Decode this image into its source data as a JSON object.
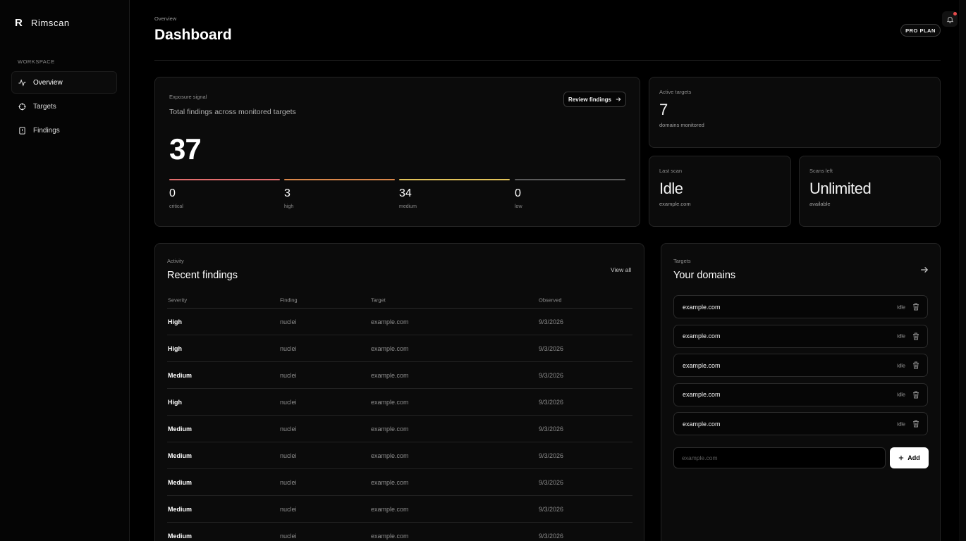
{
  "brand": {
    "mark": "R",
    "name": "Rimscan"
  },
  "sidebar": {
    "section_label": "WORKSPACE",
    "items": [
      {
        "label": "Overview",
        "icon": "activity-icon",
        "active": true
      },
      {
        "label": "Targets",
        "icon": "crosshair-icon",
        "active": false
      },
      {
        "label": "Findings",
        "icon": "file-icon",
        "active": false
      }
    ]
  },
  "header": {
    "breadcrumb": "Overview",
    "title": "Dashboard",
    "plan_badge": "PRO PLAN"
  },
  "exposure": {
    "label": "Exposure signal",
    "subtitle": "Total findings across monitored targets",
    "total": "37",
    "review_button": "Review findings",
    "severities": [
      {
        "count": "0",
        "label": "critical",
        "color": "#e26d6d"
      },
      {
        "count": "3",
        "label": "high",
        "color": "#d9874a"
      },
      {
        "count": "34",
        "label": "medium",
        "color": "#e2c35a"
      },
      {
        "count": "0",
        "label": "low",
        "color": "#5a5a5a"
      }
    ]
  },
  "stats": {
    "active_targets": {
      "label": "Active targets",
      "value": "7",
      "caption": "domains monitored"
    },
    "last_scan": {
      "label": "Last scan",
      "value": "Idle",
      "caption": "example.com"
    },
    "scans_left": {
      "label": "Scans left",
      "value": "Unlimited",
      "caption": "available"
    }
  },
  "recent": {
    "label": "Activity",
    "title": "Recent findings",
    "view_all": "View all",
    "columns": [
      "Severity",
      "Finding",
      "Target",
      "Observed"
    ],
    "rows": [
      {
        "severity": "High",
        "finding": "nuclei",
        "target": "example.com",
        "observed": "9/3/2026"
      },
      {
        "severity": "High",
        "finding": "nuclei",
        "target": "example.com",
        "observed": "9/3/2026"
      },
      {
        "severity": "Medium",
        "finding": "nuclei",
        "target": "example.com",
        "observed": "9/3/2026"
      },
      {
        "severity": "High",
        "finding": "nuclei",
        "target": "example.com",
        "observed": "9/3/2026"
      },
      {
        "severity": "Medium",
        "finding": "nuclei",
        "target": "example.com",
        "observed": "9/3/2026"
      },
      {
        "severity": "Medium",
        "finding": "nuclei",
        "target": "example.com",
        "observed": "9/3/2026"
      },
      {
        "severity": "Medium",
        "finding": "nuclei",
        "target": "example.com",
        "observed": "9/3/2026"
      },
      {
        "severity": "Medium",
        "finding": "nuclei",
        "target": "example.com",
        "observed": "9/3/2026"
      },
      {
        "severity": "Medium",
        "finding": "nuclei",
        "target": "example.com",
        "observed": "9/3/2026"
      }
    ]
  },
  "domains": {
    "label": "Targets",
    "title": "Your domains",
    "items": [
      {
        "name": "example.com",
        "status": "Idle"
      },
      {
        "name": "example.com",
        "status": "Idle"
      },
      {
        "name": "example.com",
        "status": "Idle"
      },
      {
        "name": "example.com",
        "status": "Idle"
      },
      {
        "name": "example.com",
        "status": "Idle"
      }
    ],
    "input_placeholder": "example.com",
    "add_button": "Add"
  }
}
